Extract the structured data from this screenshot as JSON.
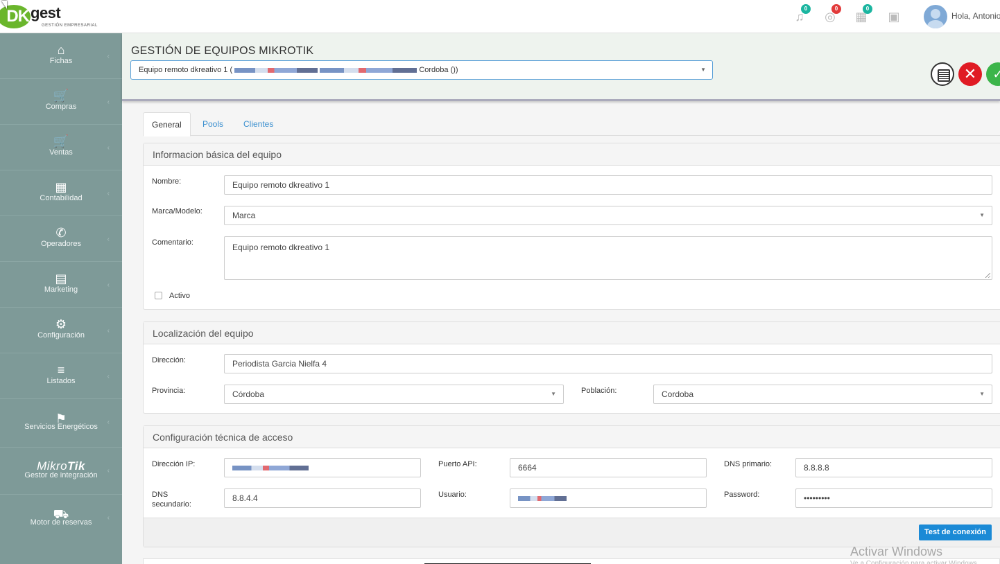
{
  "brand": {
    "logo_prefix": "DK",
    "logo_word": "gest",
    "logo_tagline": "GESTIÓN EMPRESARIAL"
  },
  "topbar": {
    "notifications": [
      {
        "icon": "bell-icon",
        "count": "0",
        "color": "#1bb5a0"
      },
      {
        "icon": "globe-icon",
        "count": "0",
        "color": "#e23b3b"
      },
      {
        "icon": "calendar-icon",
        "count": "0",
        "color": "#1bb5a0"
      },
      {
        "icon": "grid-icon",
        "count": "",
        "color": ""
      }
    ],
    "greeting": "Hola, Antonio"
  },
  "sidebar": {
    "items": [
      {
        "name": "fichas",
        "icon": "⌂",
        "label": "Fichas"
      },
      {
        "name": "compras",
        "icon": "🛒",
        "label": "Compras"
      },
      {
        "name": "ventas",
        "icon": "🛒",
        "label": "Ventas"
      },
      {
        "name": "contabilidad",
        "icon": "▦",
        "label": "Contabilidad"
      },
      {
        "name": "operadores",
        "icon": "✆",
        "label": "Operadores"
      },
      {
        "name": "marketing",
        "icon": "▤",
        "label": "Marketing"
      },
      {
        "name": "configuracion",
        "icon": "⚙",
        "label": "Configuración"
      },
      {
        "name": "listados",
        "icon": "≡",
        "label": "Listados"
      },
      {
        "name": "servicios",
        "icon": "⚑",
        "label": "Servicios Energéticos"
      },
      {
        "name": "mikrotik",
        "icon": "",
        "label": "Gestor de integración"
      },
      {
        "name": "reservas",
        "icon": "⛟",
        "label": "Motor de reservas"
      }
    ],
    "mikrotik_logo_a": "Mikro",
    "mikrotik_logo_b": "Tik"
  },
  "header": {
    "title": "GESTIÓN DE EQUIPOS MIKROTIK",
    "device_select": {
      "prefix": "Equipo remoto dkreativo 1 (",
      "suffix": "Cordoba ())"
    }
  },
  "tabs": [
    "General",
    "Pools",
    "Clientes"
  ],
  "basic": {
    "title": "Informacion básica del equipo",
    "nombre_label": "Nombre:",
    "nombre_value": "Equipo remoto dkreativo 1",
    "marca_label": "Marca/Modelo:",
    "marca_value": "Marca",
    "comentario_label": "Comentario:",
    "comentario_value": "Equipo remoto dkreativo 1",
    "activo_label": "Activo",
    "activo_checked": false
  },
  "location": {
    "title": "Localización del equipo",
    "direccion_label": "Dirección:",
    "direccion_value": "Periodista Garcia Nielfa 4",
    "provincia_label": "Provincia:",
    "provincia_value": "Córdoba",
    "poblacion_label": "Población:",
    "poblacion_value": "Cordoba"
  },
  "access": {
    "title": "Configuración técnica de acceso",
    "ip_label": "Dirección IP:",
    "puerto_label": "Puerto API:",
    "puerto_value": "6664",
    "dns1_label": "DNS primario:",
    "dns1_value": "8.8.8.8",
    "dns2_label": "DNS secundario:",
    "dns2_value": "8.8.4.4",
    "usuario_label": "Usuario:",
    "password_label": "Password:",
    "password_value": "•••••••••",
    "test_button": "Test de conexión"
  },
  "watermark": {
    "title": "Activar Windows",
    "subtitle": "Ve a Configuración para activar Windows."
  }
}
